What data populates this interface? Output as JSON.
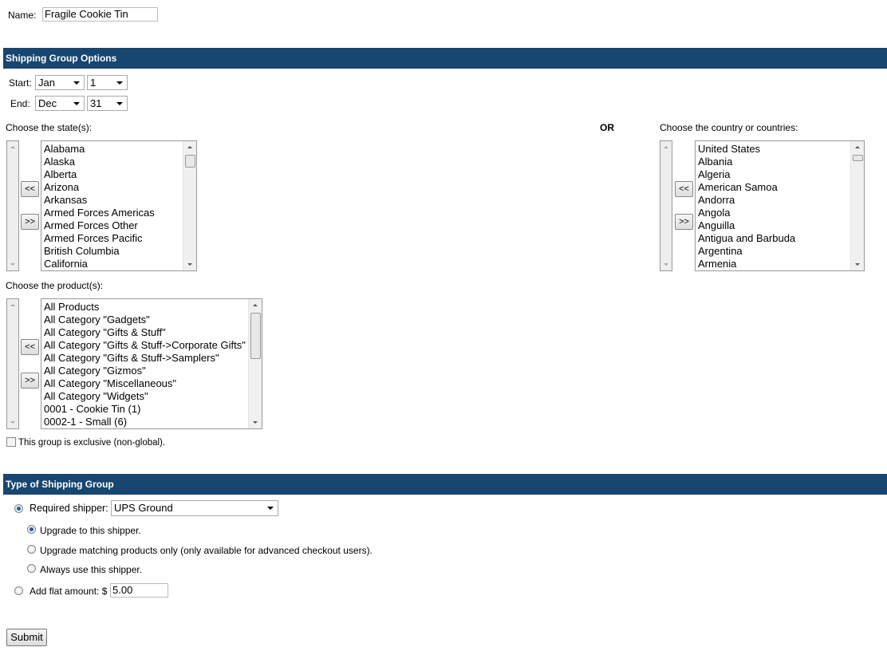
{
  "name": {
    "label": "Name:",
    "value": "Fragile Cookie Tin"
  },
  "options": {
    "header": "Shipping Group Options",
    "start_label": "Start:",
    "start_month": "Jan",
    "start_day": "1",
    "end_label": "End:",
    "end_month": "Dec",
    "end_day": "31",
    "states_label": "Choose the state(s):",
    "or_label": "OR",
    "countries_label": "Choose the country or countries:",
    "move_left": "<<",
    "move_right": ">>",
    "states": [
      "Alabama",
      "Alaska",
      "Alberta",
      "Arizona",
      "Arkansas",
      "Armed Forces Americas",
      "Armed Forces Other",
      "Armed Forces Pacific",
      "British Columbia",
      "California"
    ],
    "countries": [
      "United States",
      "Albania",
      "Algeria",
      "American Samoa",
      "Andorra",
      "Angola",
      "Anguilla",
      "Antigua and Barbuda",
      "Argentina",
      "Armenia"
    ],
    "products_label": "Choose the product(s):",
    "products": [
      "All Products",
      "All Category \"Gadgets\"",
      "All Category \"Gifts & Stuff\"",
      "All Category \"Gifts & Stuff->Corporate Gifts\"",
      "All Category \"Gifts & Stuff->Samplers\"",
      "All Category \"Gizmos\"",
      "All Category \"Miscellaneous\"",
      "All Category \"Widgets\"",
      "0001 - Cookie Tin (1)",
      "0002-1 - Small (6)"
    ],
    "exclusive_label": "This group is exclusive (non-global).",
    "exclusive_checked": false
  },
  "type": {
    "header": "Type of Shipping Group",
    "required_label": "Required shipper:",
    "required_selected": true,
    "shipper": "UPS Ground",
    "sub_options": [
      {
        "label": "Upgrade to this shipper.",
        "selected": true
      },
      {
        "label": "Upgrade matching products only (only available for advanced checkout users).",
        "selected": false
      },
      {
        "label": "Always use this shipper.",
        "selected": false
      }
    ],
    "flat_label": "Add flat amount: $",
    "flat_value": "5.00",
    "flat_selected": false
  },
  "submit_label": "Submit",
  "colors": {
    "header_bg": "#174670",
    "radio_accent": "#1f5fa8"
  }
}
